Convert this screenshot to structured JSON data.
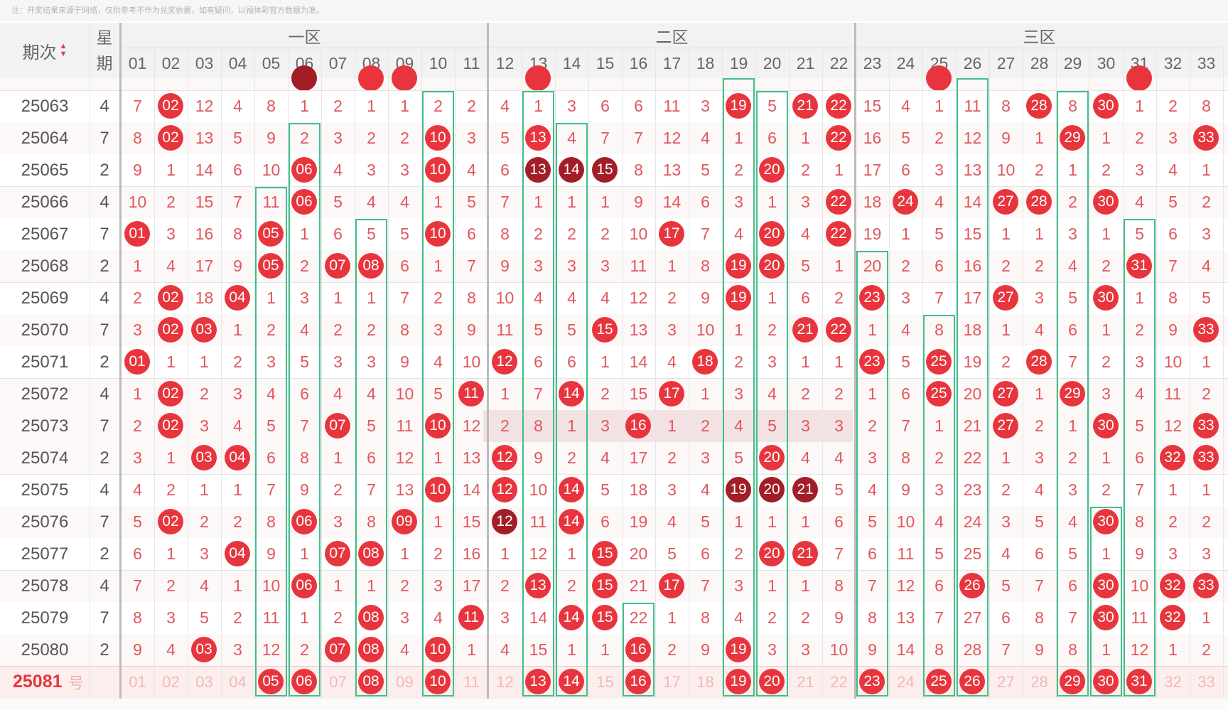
{
  "note": "注：开奖结果来源于网络，仅供参考不作为兑奖依据，如有疑问，以福体彩官方数据为准。",
  "header": {
    "issue_label": "期次",
    "week_label": "星\n期",
    "zones": [
      {
        "name": "一区",
        "from": 1,
        "to": 11
      },
      {
        "name": "二区",
        "from": 12,
        "to": 22
      },
      {
        "name": "三区",
        "from": 23,
        "to": 33
      }
    ],
    "numbers": [
      "01",
      "02",
      "03",
      "04",
      "05",
      "06",
      "07",
      "08",
      "09",
      "10",
      "11",
      "12",
      "13",
      "14",
      "15",
      "16",
      "17",
      "18",
      "19",
      "20",
      "21",
      "22",
      "23",
      "24",
      "25",
      "26",
      "27",
      "28",
      "29",
      "30",
      "31",
      "32",
      "33"
    ]
  },
  "partial_top_balls": [
    6,
    8,
    9,
    13,
    25,
    31
  ],
  "rows": [
    {
      "issue": "25063",
      "week": "4",
      "cells": [
        "7",
        "02",
        "12",
        "4",
        "8",
        "1",
        "2",
        "1",
        "1",
        "2",
        "2",
        "4",
        "1",
        "3",
        "6",
        "6",
        "11",
        "3",
        "19",
        "5",
        "21",
        "22",
        "15",
        "4",
        "1",
        "11",
        "8",
        "28",
        "8",
        "30",
        "1",
        "2",
        "8"
      ]
    },
    {
      "issue": "25064",
      "week": "7",
      "cells": [
        "8",
        "02",
        "13",
        "5",
        "9",
        "2",
        "3",
        "2",
        "2",
        "10",
        "3",
        "5",
        "13",
        "4",
        "7",
        "7",
        "12",
        "4",
        "1",
        "6",
        "1",
        "22",
        "16",
        "5",
        "2",
        "12",
        "9",
        "1",
        "29",
        "1",
        "2",
        "3",
        "33"
      ]
    },
    {
      "issue": "25065",
      "week": "2",
      "cells": [
        "9",
        "1",
        "14",
        "6",
        "10",
        "06",
        "4",
        "3",
        "3",
        "10",
        "4",
        "6",
        "13",
        "14",
        "15",
        "8",
        "13",
        "5",
        "2",
        "20",
        "2",
        "1",
        "17",
        "6",
        "3",
        "13",
        "10",
        "2",
        "1",
        "2",
        "3",
        "4",
        "1"
      ]
    },
    {
      "issue": "25066",
      "week": "4",
      "cells": [
        "10",
        "2",
        "15",
        "7",
        "11",
        "06",
        "5",
        "4",
        "4",
        "1",
        "5",
        "7",
        "1",
        "1",
        "1",
        "9",
        "14",
        "6",
        "3",
        "1",
        "3",
        "22",
        "18",
        "24",
        "4",
        "14",
        "27",
        "28",
        "2",
        "30",
        "4",
        "5",
        "2"
      ]
    },
    {
      "issue": "25067",
      "week": "7",
      "cells": [
        "01",
        "3",
        "16",
        "8",
        "05",
        "1",
        "6",
        "5",
        "5",
        "10",
        "6",
        "8",
        "2",
        "2",
        "2",
        "10",
        "17",
        "7",
        "4",
        "20",
        "4",
        "22",
        "19",
        "1",
        "5",
        "15",
        "1",
        "1",
        "3",
        "1",
        "5",
        "6",
        "3"
      ]
    },
    {
      "issue": "25068",
      "week": "2",
      "cells": [
        "1",
        "4",
        "17",
        "9",
        "05",
        "2",
        "07",
        "08",
        "6",
        "1",
        "7",
        "9",
        "3",
        "3",
        "3",
        "11",
        "1",
        "8",
        "19",
        "20",
        "5",
        "1",
        "20",
        "2",
        "6",
        "16",
        "2",
        "2",
        "4",
        "2",
        "31",
        "7",
        "4"
      ]
    },
    {
      "issue": "25069",
      "week": "4",
      "cells": [
        "2",
        "02",
        "18",
        "04",
        "1",
        "3",
        "1",
        "1",
        "7",
        "2",
        "8",
        "10",
        "4",
        "4",
        "4",
        "12",
        "2",
        "9",
        "19",
        "1",
        "6",
        "2",
        "23",
        "3",
        "7",
        "17",
        "27",
        "3",
        "5",
        "30",
        "1",
        "8",
        "5"
      ]
    },
    {
      "issue": "25070",
      "week": "7",
      "cells": [
        "3",
        "02",
        "03",
        "1",
        "2",
        "4",
        "2",
        "2",
        "8",
        "3",
        "9",
        "11",
        "5",
        "5",
        "15",
        "13",
        "3",
        "10",
        "1",
        "2",
        "21",
        "22",
        "1",
        "4",
        "8",
        "18",
        "1",
        "4",
        "6",
        "1",
        "2",
        "9",
        "33"
      ]
    },
    {
      "issue": "25071",
      "week": "2",
      "cells": [
        "01",
        "1",
        "1",
        "2",
        "3",
        "5",
        "3",
        "3",
        "9",
        "4",
        "10",
        "12",
        "6",
        "6",
        "1",
        "14",
        "4",
        "18",
        "2",
        "3",
        "1",
        "1",
        "23",
        "5",
        "25",
        "19",
        "2",
        "28",
        "7",
        "2",
        "3",
        "10",
        "1"
      ]
    },
    {
      "issue": "25072",
      "week": "4",
      "cells": [
        "1",
        "02",
        "2",
        "3",
        "4",
        "6",
        "4",
        "4",
        "10",
        "5",
        "11",
        "1",
        "7",
        "14",
        "2",
        "15",
        "17",
        "1",
        "3",
        "4",
        "2",
        "2",
        "1",
        "6",
        "25",
        "20",
        "27",
        "1",
        "29",
        "3",
        "4",
        "11",
        "2"
      ]
    },
    {
      "issue": "25073",
      "week": "7",
      "cells": [
        "2",
        "02",
        "3",
        "4",
        "5",
        "7",
        "07",
        "5",
        "11",
        "10",
        "12",
        "2",
        "8",
        "1",
        "3",
        "16",
        "1",
        "2",
        "4",
        "5",
        "3",
        "3",
        "2",
        "7",
        "1",
        "21",
        "27",
        "2",
        "1",
        "30",
        "5",
        "12",
        "33"
      ]
    },
    {
      "issue": "25074",
      "week": "2",
      "cells": [
        "3",
        "1",
        "03",
        "04",
        "6",
        "8",
        "1",
        "6",
        "12",
        "1",
        "13",
        "12",
        "9",
        "2",
        "4",
        "17",
        "2",
        "3",
        "5",
        "20",
        "4",
        "4",
        "3",
        "8",
        "2",
        "22",
        "1",
        "3",
        "2",
        "1",
        "6",
        "32",
        "33"
      ]
    },
    {
      "issue": "25075",
      "week": "4",
      "cells": [
        "4",
        "2",
        "1",
        "1",
        "7",
        "9",
        "2",
        "7",
        "13",
        "10",
        "14",
        "12",
        "10",
        "14",
        "5",
        "18",
        "3",
        "4",
        "19",
        "20",
        "21",
        "5",
        "4",
        "9",
        "3",
        "23",
        "2",
        "4",
        "3",
        "2",
        "7",
        "1",
        "1"
      ]
    },
    {
      "issue": "25076",
      "week": "7",
      "cells": [
        "5",
        "02",
        "2",
        "2",
        "8",
        "06",
        "3",
        "8",
        "09",
        "1",
        "15",
        "12",
        "11",
        "14",
        "6",
        "19",
        "4",
        "5",
        "1",
        "1",
        "1",
        "6",
        "5",
        "10",
        "4",
        "24",
        "3",
        "5",
        "4",
        "30",
        "8",
        "2",
        "2"
      ]
    },
    {
      "issue": "25077",
      "week": "2",
      "cells": [
        "6",
        "1",
        "3",
        "04",
        "9",
        "1",
        "07",
        "08",
        "1",
        "2",
        "16",
        "1",
        "12",
        "1",
        "15",
        "20",
        "5",
        "6",
        "2",
        "20",
        "21",
        "7",
        "6",
        "11",
        "5",
        "25",
        "4",
        "6",
        "5",
        "1",
        "9",
        "3",
        "3"
      ]
    },
    {
      "issue": "25078",
      "week": "4",
      "cells": [
        "7",
        "2",
        "4",
        "1",
        "10",
        "06",
        "1",
        "1",
        "2",
        "3",
        "17",
        "2",
        "13",
        "2",
        "15",
        "21",
        "17",
        "7",
        "3",
        "1",
        "1",
        "8",
        "7",
        "12",
        "6",
        "26",
        "5",
        "7",
        "6",
        "30",
        "10",
        "32",
        "33"
      ]
    },
    {
      "issue": "25079",
      "week": "7",
      "cells": [
        "8",
        "3",
        "5",
        "2",
        "11",
        "1",
        "2",
        "08",
        "3",
        "4",
        "11",
        "3",
        "14",
        "14",
        "15",
        "22",
        "1",
        "8",
        "4",
        "2",
        "2",
        "9",
        "8",
        "13",
        "7",
        "27",
        "6",
        "8",
        "7",
        "30",
        "11",
        "32",
        "1"
      ]
    },
    {
      "issue": "25080",
      "week": "2",
      "cells": [
        "9",
        "4",
        "03",
        "3",
        "12",
        "2",
        "07",
        "08",
        "4",
        "10",
        "1",
        "4",
        "15",
        "1",
        "1",
        "16",
        "2",
        "9",
        "19",
        "3",
        "3",
        "10",
        "9",
        "14",
        "8",
        "28",
        "7",
        "9",
        "8",
        "1",
        "12",
        "1",
        "2"
      ]
    }
  ],
  "dark_balls": [
    [
      "25065",
      "13"
    ],
    [
      "25065",
      "14"
    ],
    [
      "25065",
      "15"
    ],
    [
      "25075",
      "19"
    ],
    [
      "25075",
      "20"
    ],
    [
      "25075",
      "21"
    ],
    [
      "25076",
      "12"
    ]
  ],
  "current": {
    "issue": "25081",
    "suffix": "号",
    "selected": [
      "05",
      "06",
      "08",
      "10",
      "13",
      "14",
      "16",
      "19",
      "20",
      "23",
      "25",
      "26",
      "29",
      "30",
      "31"
    ]
  },
  "colors": {
    "red": "#e8353d",
    "dark": "#a31d27",
    "box": "#3fc08a",
    "miss_text": "#e0575c"
  }
}
